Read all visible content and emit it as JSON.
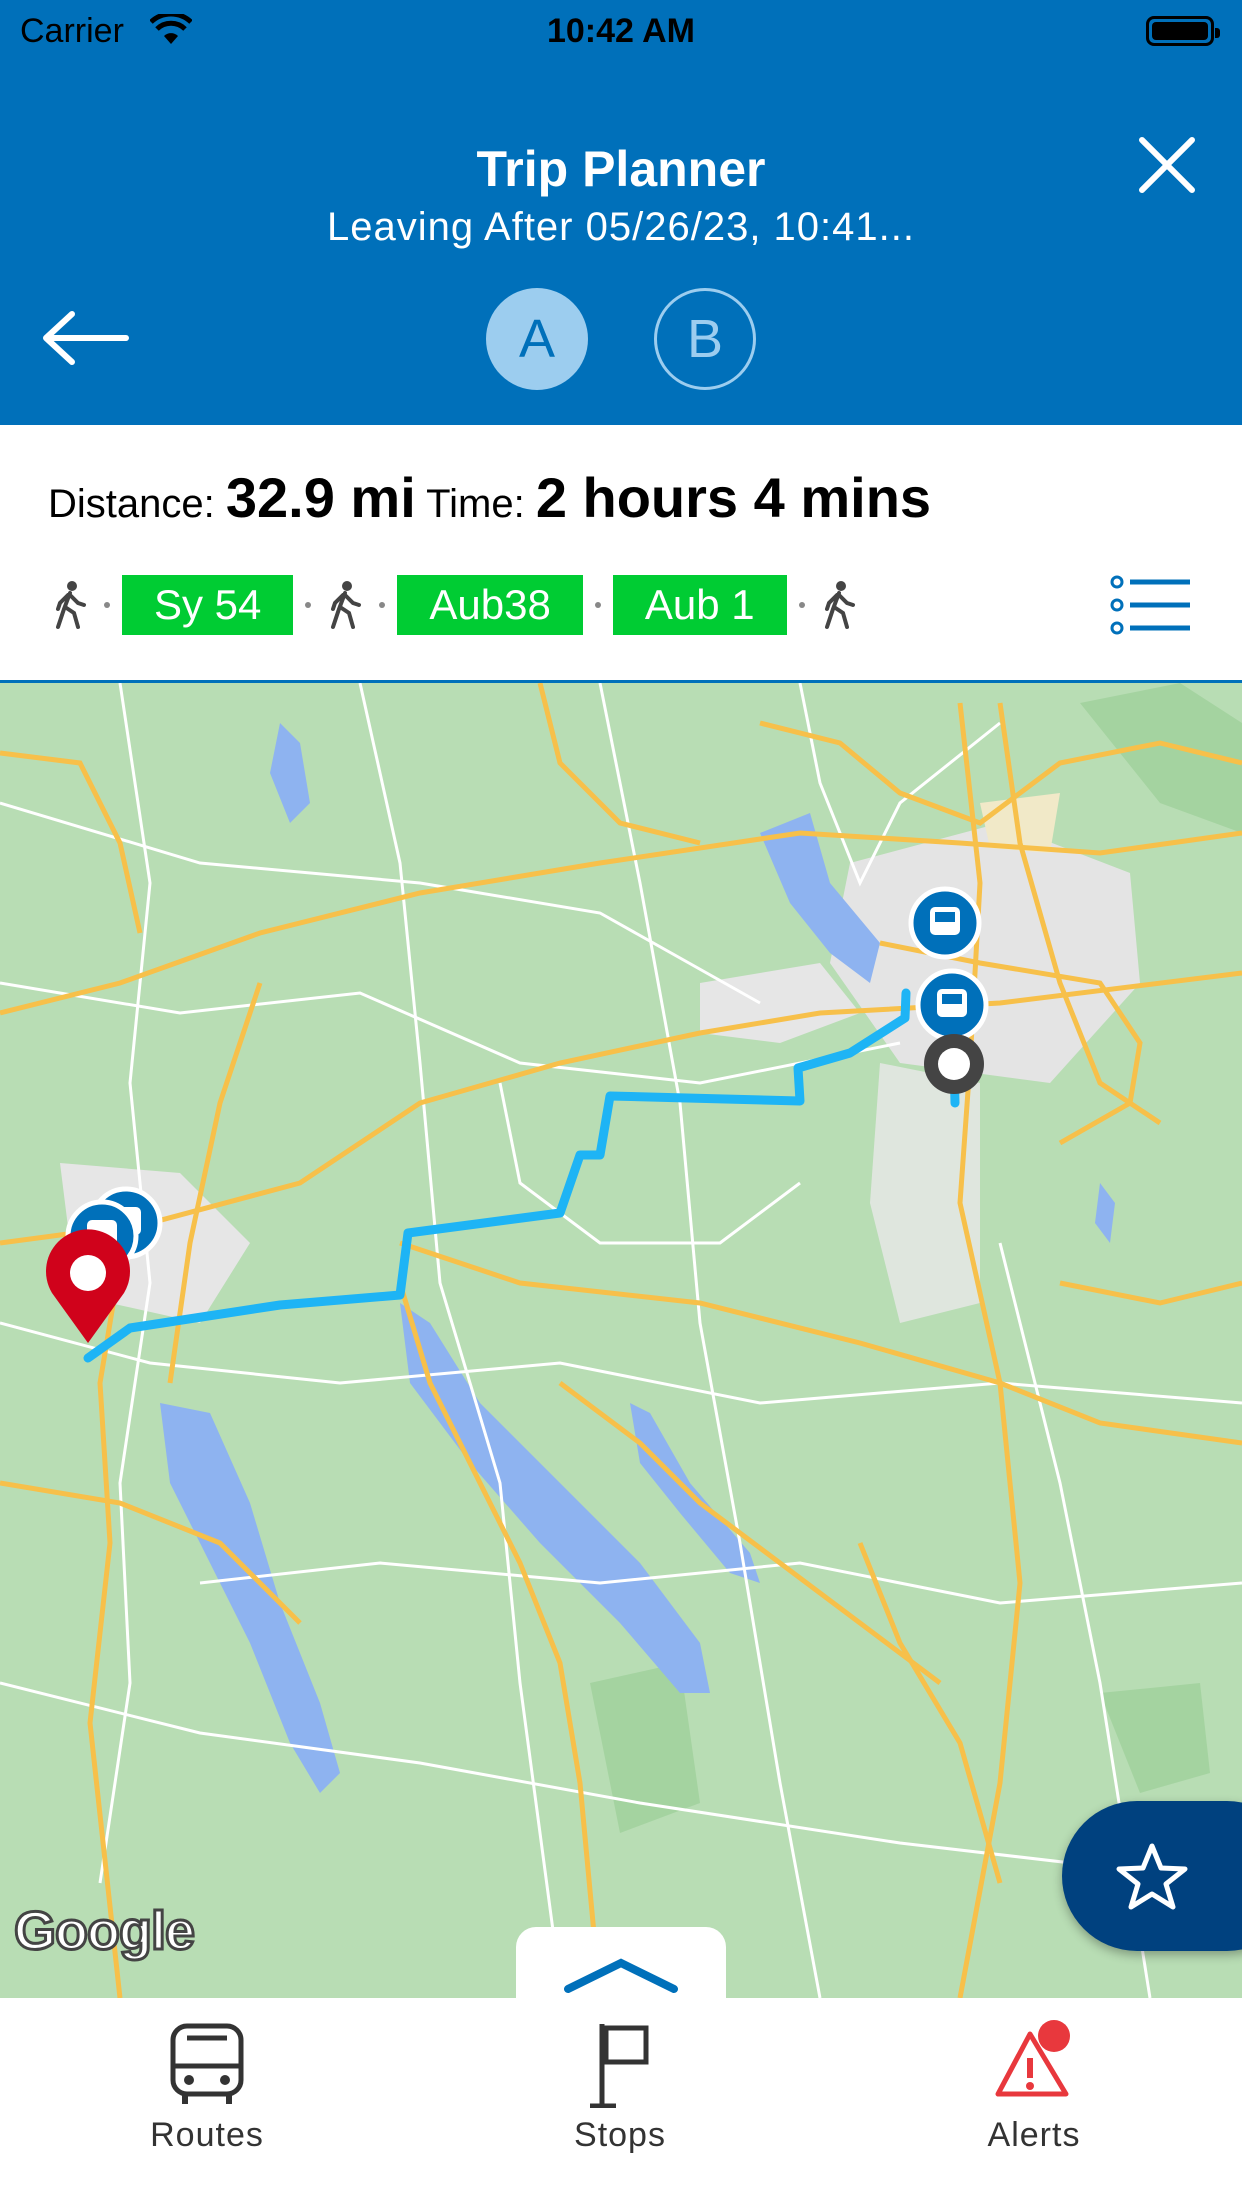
{
  "status_bar": {
    "carrier": "Carrier",
    "time": "10:42 AM"
  },
  "header": {
    "title": "Trip Planner",
    "subtitle": "Leaving After 05/26/23, 10:41...",
    "point_a": "A",
    "point_b": "B",
    "background_color": "#0070BA"
  },
  "summary": {
    "distance_label": "Distance:",
    "distance_value": "32.9 mi",
    "time_label": "Time:",
    "time_value": "2 hours 4 mins"
  },
  "legs": [
    {
      "type": "walk",
      "icon": "walk-icon"
    },
    {
      "type": "bus",
      "label": "Sy 54"
    },
    {
      "type": "walk",
      "icon": "walk-icon"
    },
    {
      "type": "bus",
      "label": "Aub38"
    },
    {
      "type": "bus",
      "label": "Aub 1"
    },
    {
      "type": "walk",
      "icon": "walk-icon"
    }
  ],
  "colors": {
    "route_badge": "#00CC33",
    "route_line": "#1EB4F5",
    "destination_pin": "#D0021B",
    "favorite_button": "#00417F",
    "alert_icon": "#E8383D"
  },
  "map": {
    "attribution": "Google"
  },
  "tabbar": {
    "routes": "Routes",
    "stops": "Stops",
    "alerts": "Alerts"
  }
}
